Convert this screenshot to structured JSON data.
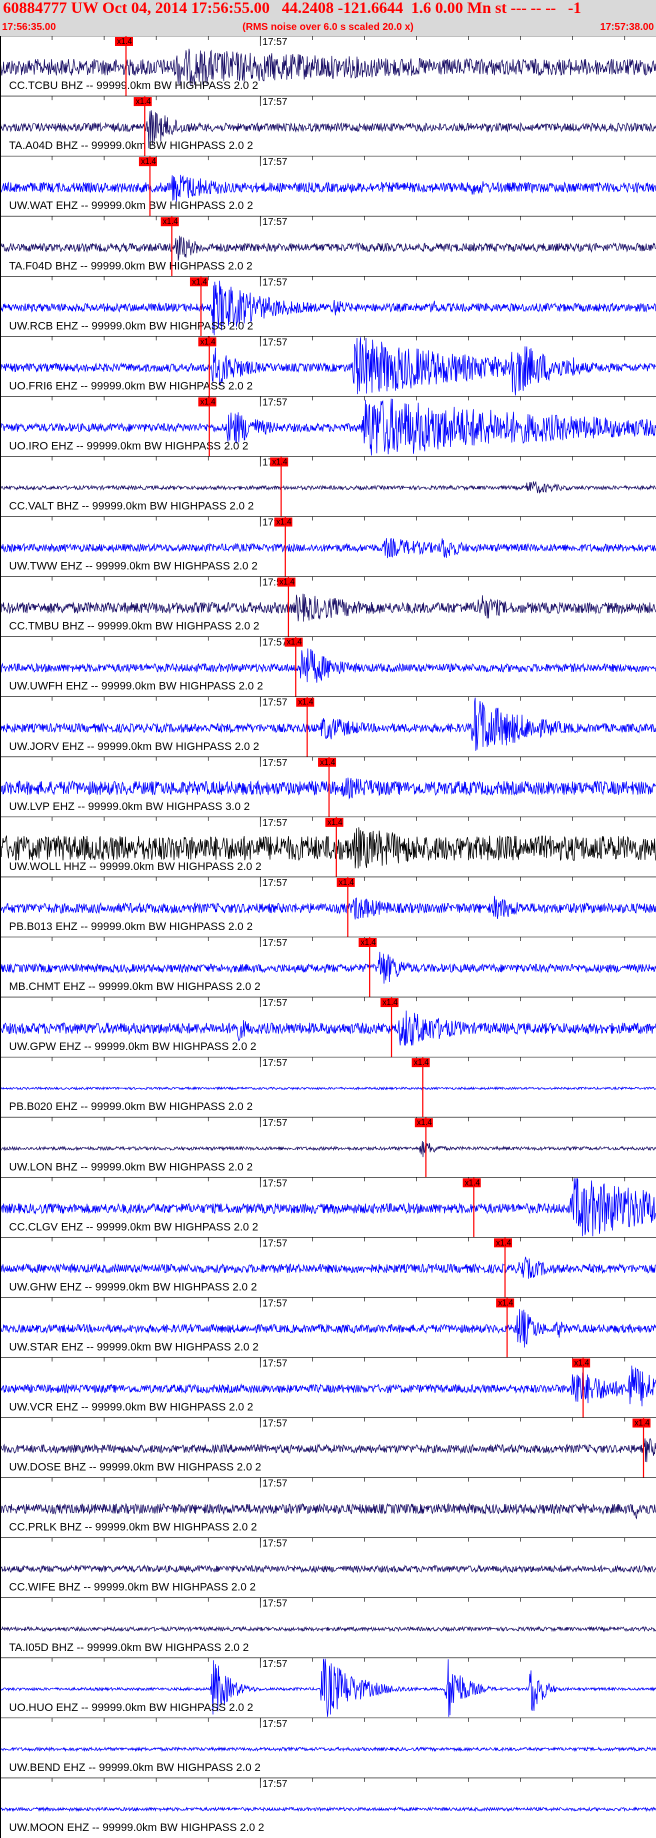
{
  "header": {
    "title": "60884777 UW Oct 04, 2014 17:56:55.00   44.2408 -121.6644  1.6 0.00 Mn st --- -- --   -1",
    "start_time": "17:56:35.00",
    "note": "(RMS noise over 6.0 s scaled 20.0 x)",
    "end_time": "17:57:38.00"
  },
  "colors": {
    "header_bg": "#d9d9d9",
    "header_text": "#ff0000",
    "pick": "#ff0000",
    "blue": "#0000ff",
    "navy": "#1a0f66",
    "black": "#000000"
  },
  "chart_data": {
    "type": "line",
    "title": "60884777 UW Oct 04, 2014 17:56:55.00   44.2408 -121.6644  1.6 0.00 Mn st --- -- --   -1",
    "x_start": "17:56:35.00",
    "x_end": "17:57:38.00",
    "x_start_sec": 0,
    "x_end_sec": 63,
    "minute_mark_label": "17:57",
    "minute_mark_sec": 25,
    "pick_label": "x1.4",
    "grid": false,
    "series": [
      {
        "name": "CC.TCBU BHZ -- 99999.0km BW  HIGHPASS  2.0  2",
        "color": "#1a0f66",
        "amp": 0.3,
        "pick_sec": 12.1,
        "bursts": [
          [
            17,
            0.7,
            30
          ]
        ]
      },
      {
        "name": "TA.A04D BHZ -- 99999.0km BW  HIGHPASS  2.0  2",
        "color": "#1a0f66",
        "amp": 0.15,
        "pick_sec": 13.9,
        "bursts": [
          [
            14.3,
            0.8,
            2.5
          ]
        ]
      },
      {
        "name": "UW.WAT EHZ -- 99999.0km BW  HIGHPASS  2.0  2",
        "color": "#0000ff",
        "amp": 0.18,
        "pick_sec": 14.4,
        "bursts": [
          [
            16.5,
            0.6,
            5
          ],
          [
            45,
            0.3,
            5
          ]
        ]
      },
      {
        "name": "TA.F04D BHZ -- 99999.0km BW  HIGHPASS  2.0  2",
        "color": "#1a0f66",
        "amp": 0.15,
        "pick_sec": 16.5,
        "bursts": [
          [
            16.9,
            0.6,
            2
          ]
        ]
      },
      {
        "name": "UW.RCB EHZ -- 99999.0km BW  HIGHPASS  2.0  2",
        "color": "#0000ff",
        "amp": 0.15,
        "pick_sec": 19.3,
        "bursts": [
          [
            20.5,
            1.1,
            5
          ],
          [
            32,
            0.35,
            2
          ],
          [
            41.5,
            0.3,
            1.5
          ]
        ]
      },
      {
        "name": "UO.FRI6 EHZ -- 99999.0km BW  HIGHPASS  2.0  2",
        "color": "#0000ff",
        "amp": 0.15,
        "pick_sec": 20.1,
        "bursts": [
          [
            20.5,
            0.8,
            3
          ],
          [
            34,
            1.2,
            12
          ],
          [
            49,
            1.2,
            4
          ],
          [
            55,
            0.5,
            0.8
          ]
        ]
      },
      {
        "name": "UO.IRO EHZ -- 99999.0km BW  HIGHPASS  2.0  2",
        "color": "#0000ff",
        "amp": 0.15,
        "pick_sec": 20.1,
        "bursts": [
          [
            22,
            0.8,
            3
          ],
          [
            35,
            1.2,
            20
          ]
        ]
      },
      {
        "name": "CC.VALT BHZ -- 99999.0km BW  HIGHPASS  2.0  2",
        "color": "#1a0f66",
        "amp": 0.07,
        "pick_sec": 27.0,
        "bursts": [
          [
            50.7,
            0.3,
            3
          ]
        ]
      },
      {
        "name": "UW.TWW EHZ -- 99999.0km BW  HIGHPASS  2.0  2",
        "color": "#0000ff",
        "amp": 0.14,
        "pick_sec": 27.4,
        "bursts": [
          [
            37,
            0.4,
            6
          ],
          [
            42.5,
            0.5,
            2
          ]
        ]
      },
      {
        "name": "CC.TMBU BHZ -- 99999.0km BW  HIGHPASS  2.0  2",
        "color": "#1a0f66",
        "amp": 0.2,
        "pick_sec": 27.7,
        "bursts": [
          [
            28.5,
            0.55,
            8
          ],
          [
            46,
            0.55,
            3
          ]
        ]
      },
      {
        "name": "UW.UWFH EHZ -- 99999.0km BW  HIGHPASS  2.0  2",
        "color": "#0000ff",
        "amp": 0.15,
        "pick_sec": 28.4,
        "bursts": [
          [
            29,
            0.9,
            3
          ]
        ]
      },
      {
        "name": "UW.JORV EHZ -- 99999.0km BW  HIGHPASS  2.0  2",
        "color": "#0000ff",
        "amp": 0.16,
        "pick_sec": 29.5,
        "bursts": [
          [
            31,
            0.5,
            4
          ],
          [
            45.5,
            1.2,
            5
          ]
        ]
      },
      {
        "name": "UW.LVP EHZ -- 99999.0km BW  HIGHPASS  3.0  2",
        "color": "#0000ff",
        "amp": 0.25,
        "pick_sec": 31.6,
        "bursts": [
          [
            33,
            0.4,
            10
          ]
        ]
      },
      {
        "name": "UW.WOLL HHZ -- 99999.0km BW  HIGHPASS  2.0  2",
        "color": "#000000",
        "amp": 0.45,
        "pick_sec": 32.3,
        "bursts": [
          [
            34,
            0.8,
            12
          ]
        ]
      },
      {
        "name": "PB.B013 EHZ -- 99999.0km BW  HIGHPASS  2.0  2",
        "color": "#0000ff",
        "amp": 0.18,
        "pick_sec": 33.4,
        "bursts": [
          [
            34,
            0.5,
            4
          ],
          [
            47.5,
            0.5,
            3
          ]
        ]
      },
      {
        "name": "MB.CHMT EHZ -- 99999.0km BW  HIGHPASS  2.0  2",
        "color": "#0000ff",
        "amp": 0.15,
        "pick_sec": 35.5,
        "bursts": [
          [
            36.5,
            0.8,
            2
          ]
        ]
      },
      {
        "name": "UW.GPW EHZ -- 99999.0km BW  HIGHPASS  2.0  2",
        "color": "#0000ff",
        "amp": 0.2,
        "pick_sec": 37.6,
        "bursts": [
          [
            22.5,
            0.6,
            1.5
          ],
          [
            38.5,
            0.8,
            5
          ]
        ]
      },
      {
        "name": "PB.B020 EHZ -- 99999.0km BW  HIGHPASS  2.0  2",
        "color": "#0000ff",
        "amp": 0.04,
        "pick_sec": 40.6,
        "bursts": []
      },
      {
        "name": "UW.LON BHZ -- 99999.0km BW  HIGHPASS  2.0  2",
        "color": "#1a0f66",
        "amp": 0.06,
        "pick_sec": 40.9,
        "bursts": [
          [
            40.5,
            0.35,
            1.5
          ]
        ]
      },
      {
        "name": "CC.CLGV EHZ -- 99999.0km BW  HIGHPASS  2.0  2",
        "color": "#0000ff",
        "amp": 0.18,
        "pick_sec": 45.5,
        "bursts": [
          [
            55,
            1.2,
            12
          ]
        ]
      },
      {
        "name": "UW.GHW EHZ -- 99999.0km BW  HIGHPASS  2.0  2",
        "color": "#0000ff",
        "amp": 0.16,
        "pick_sec": 48.5,
        "bursts": [
          [
            50,
            0.5,
            3
          ]
        ]
      },
      {
        "name": "UW.STAR EHZ -- 99999.0km BW  HIGHPASS  2.0  2",
        "color": "#0000ff",
        "amp": 0.15,
        "pick_sec": 48.7,
        "bursts": [
          [
            49.8,
            1.0,
            1.5
          ],
          [
            53.5,
            0.4,
            1
          ]
        ]
      },
      {
        "name": "UW.VCR EHZ -- 99999.0km BW  HIGHPASS  2.0  2",
        "color": "#0000ff",
        "amp": 0.15,
        "pick_sec": 56.0,
        "bursts": [
          [
            55,
            0.8,
            4
          ],
          [
            60.5,
            1.0,
            3
          ]
        ]
      },
      {
        "name": "UW.DOSE BHZ -- 99999.0km BW  HIGHPASS  2.0  2",
        "color": "#1a0f66",
        "amp": 0.15,
        "pick_sec": 61.8,
        "bursts": [
          [
            62,
            0.6,
            1
          ]
        ]
      },
      {
        "name": "CC.PRLK BHZ -- 99999.0km BW  HIGHPASS  2.0  2",
        "color": "#1a0f66",
        "amp": 0.18,
        "bursts": [
          [
            61,
            0.4,
            2
          ]
        ]
      },
      {
        "name": "CC.WIFE BHZ -- 99999.0km BW  HIGHPASS  2.0  2",
        "color": "#1a0f66",
        "amp": 0.12,
        "bursts": []
      },
      {
        "name": "TA.I05D BHZ -- 99999.0km BW  HIGHPASS  2.0  2",
        "color": "#1a0f66",
        "amp": 0.07,
        "bursts": []
      },
      {
        "name": "UO.HUO EHZ -- 99999.0km BW  HIGHPASS  2.0  2",
        "color": "#0000ff",
        "amp": 0.05,
        "bursts": [
          [
            20.5,
            1.2,
            1.5
          ],
          [
            31,
            1.3,
            3
          ],
          [
            43,
            1.3,
            1.5
          ],
          [
            51,
            1.2,
            1
          ]
        ]
      },
      {
        "name": "UW.BEND EHZ -- 99999.0km BW  HIGHPASS  2.0  2",
        "color": "#0000ff",
        "amp": 0.06,
        "bursts": []
      },
      {
        "name": "UW.MOON EHZ -- 99999.0km BW  HIGHPASS  2.0  2",
        "color": "#0000ff",
        "amp": 0.06,
        "bursts": []
      }
    ]
  }
}
